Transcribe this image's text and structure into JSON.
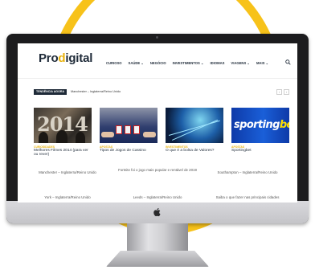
{
  "site": {
    "logo_prefix": "Pro",
    "logo_accent": "d",
    "logo_suffix": "igital"
  },
  "nav": {
    "items": [
      {
        "label": "CURIOSO"
      },
      {
        "label": "SAÚDE ⌄"
      },
      {
        "label": "NEGÓCIO"
      },
      {
        "label": "INVESTIMENTOS ⌄"
      },
      {
        "label": "IDIOMAS"
      },
      {
        "label": "VIAGENS ⌄"
      },
      {
        "label": "MAIS ⌄"
      }
    ],
    "search_icon": "search-icon"
  },
  "trending": {
    "label": "TENDÊNCIA AGORA",
    "headline": "Manchester – Inglaterra/Reino Unido",
    "prev": "‹",
    "next": "›"
  },
  "cards": [
    {
      "category": "CURIOSIDADES",
      "title": "Melhores Filmes 2014 (para ver ou rever)",
      "thumb_text": "2014"
    },
    {
      "category": "APOSTAS",
      "title": "Tipos de Jogos de Cassino"
    },
    {
      "category": "INVESTIMENTOS",
      "title": "O que é a bolsa de Valores?"
    },
    {
      "category": "APOSTAS",
      "title": "Sportingbet",
      "thumb_text": "sportingbet"
    }
  ],
  "links": [
    {
      "text": "Manchester – Inglaterra/Reino Unido"
    },
    {
      "text": "Fortnite foi o jogo mais popular e rentável de 2019"
    },
    {
      "text": "Southampton – Inglaterra/Reino Unido"
    },
    {
      "text": "York – Inglaterra/Reino Unido"
    },
    {
      "text": "Leeds – Inglaterra/Reino Unido"
    },
    {
      "text": "Saiba o que fazer nas principais cidades"
    }
  ],
  "colors": {
    "accent": "#e8b20d",
    "ring": "#f7c21a",
    "dark": "#1e2a38"
  }
}
